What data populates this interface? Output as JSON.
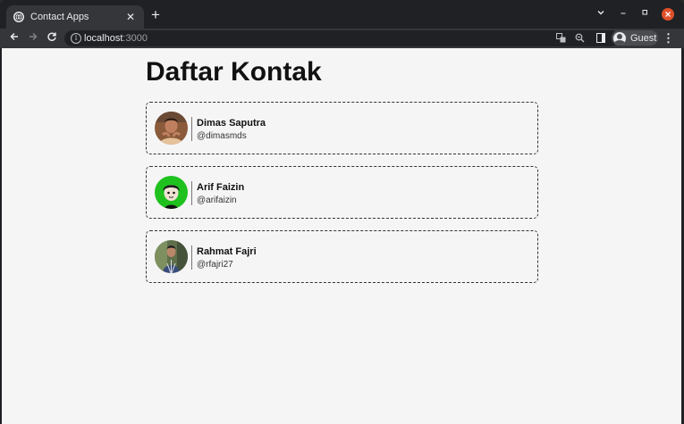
{
  "browser": {
    "tab_title": "Contact Apps",
    "tab_close": "✕",
    "new_tab": "+",
    "url_host": "localhost",
    "url_port": ":3000",
    "profile_name": "Guest",
    "icons": {
      "favicon": "globe-icon",
      "back": "arrow-left-icon",
      "forward": "arrow-right-icon",
      "reload": "reload-icon",
      "info": "info-icon",
      "translate": "translate-icon",
      "zoom": "zoom-icon",
      "sidepanel": "side-panel-icon",
      "menu": "kebab-menu-icon"
    }
  },
  "page": {
    "title": "Daftar Kontak",
    "contacts": [
      {
        "name": "Dimas Saputra",
        "handle": "@dimasmds",
        "avatar": "photo-man-brown"
      },
      {
        "name": "Arif Faizin",
        "handle": "@arifaizin",
        "avatar": "cartoon-green-bg"
      },
      {
        "name": "Rahmat Fajri",
        "handle": "@rfajri27",
        "avatar": "photo-man-outdoor"
      }
    ]
  },
  "colors": {
    "page_bg": "#f5f5f5",
    "tab_active": "#35363a",
    "window_close": "#e0502a"
  }
}
